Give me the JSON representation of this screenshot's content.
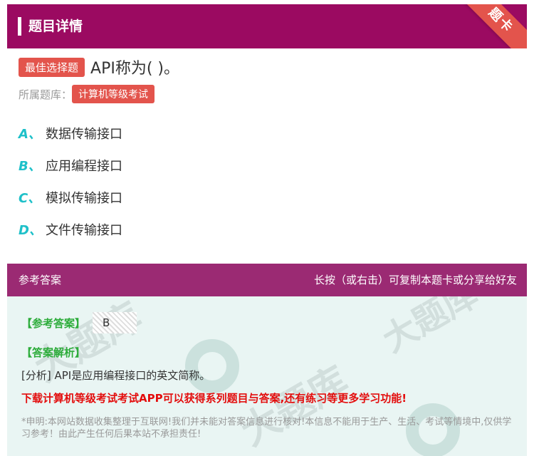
{
  "header": {
    "title": "题目详情",
    "corner_badge": "题卡"
  },
  "question": {
    "type_badge": "最佳选择题",
    "text": "API称为( )。"
  },
  "bank": {
    "label": "所属题库：",
    "name": "计算机等级考试"
  },
  "options": [
    {
      "letter": "A、",
      "text": "数据传输接口"
    },
    {
      "letter": "B、",
      "text": "应用编程接口"
    },
    {
      "letter": "C、",
      "text": "模拟传输接口"
    },
    {
      "letter": "D、",
      "text": "文件传输接口"
    }
  ],
  "answer_section": {
    "header_label": "参考答案",
    "header_hint": "长按（或右击）可复制本题卡或分享给好友",
    "answer_label": "【参考答案】",
    "answer_value": "B",
    "analysis_label": "【答案解析】",
    "analysis_text": "[分析] API是应用编程接口的英文简称。",
    "promo_text": "下载计算机等级考试考试APP可以获得系列题目与答案,还有练习等更多学习功能!",
    "disclaimer": "*申明:本网站数据收集整理于互联网!我们并未能对答案信息进行核对!本信息不能用于生产、生活、考试等情境中,仅供学习参考！由此产生任何后果本站不承担责任!"
  },
  "colors": {
    "header_bg": "#9b0a61",
    "badge_red": "#e3544c",
    "option_letter": "#1ec0c9",
    "answer_green": "#2cac3a",
    "promo_red": "#e30d0d"
  }
}
